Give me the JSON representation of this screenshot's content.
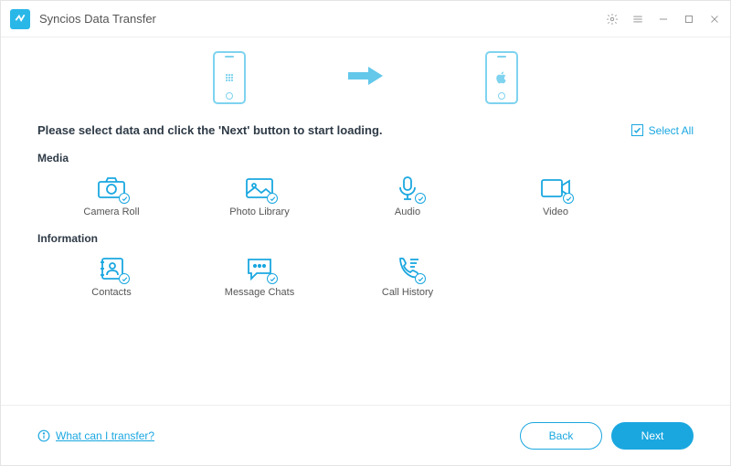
{
  "app": {
    "title": "Syncios Data Transfer"
  },
  "instruction": "Please select data and click the 'Next' button to start loading.",
  "select_all_label": "Select All",
  "sections": {
    "media": {
      "title": "Media",
      "items": [
        {
          "label": "Camera Roll"
        },
        {
          "label": "Photo Library"
        },
        {
          "label": "Audio"
        },
        {
          "label": "Video"
        }
      ]
    },
    "information": {
      "title": "Information",
      "items": [
        {
          "label": "Contacts"
        },
        {
          "label": "Message Chats"
        },
        {
          "label": "Call History"
        }
      ]
    }
  },
  "footer": {
    "help_label": "What can I transfer?",
    "back_label": "Back",
    "next_label": "Next"
  }
}
